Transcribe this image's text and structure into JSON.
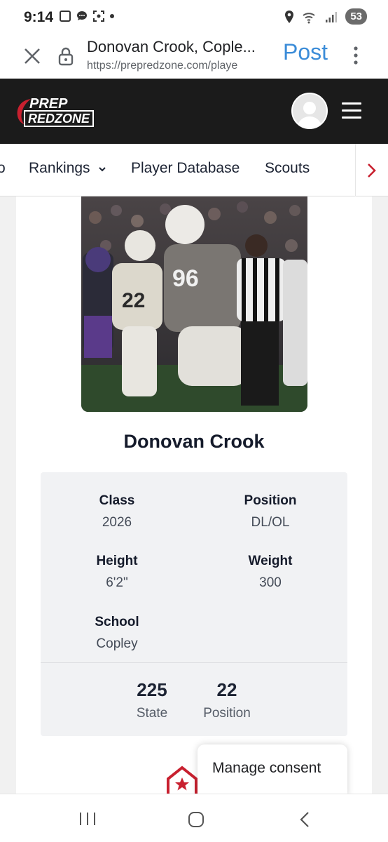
{
  "status_bar": {
    "time": "9:14",
    "battery": "53",
    "icons": [
      "notification-square-icon",
      "chat-bubble-icon",
      "screenshot-icon",
      "dot-icon",
      "location-icon",
      "wifi-icon",
      "signal-icon"
    ]
  },
  "browser": {
    "page_title": "Donovan Crook, Cople...",
    "url": "https://prepredzone.com/playe",
    "action_label": "Post",
    "accent": "#3b8cd8"
  },
  "site": {
    "logo_top": "PREP",
    "logo_bottom": "REDZONE",
    "brand_red": "#c8202f",
    "header_bg": "#1b1b1b"
  },
  "nav": {
    "partial_item": "o",
    "items": [
      "Rankings",
      "Player Database",
      "Scouts"
    ]
  },
  "player": {
    "name": "Donovan Crook",
    "fields": [
      {
        "label": "Class",
        "value": "2026"
      },
      {
        "label": "Position",
        "value": "DL/OL"
      },
      {
        "label": "Height",
        "value": "6'2\""
      },
      {
        "label": "Weight",
        "value": "300"
      },
      {
        "label": "School",
        "value": "Copley"
      }
    ],
    "ranks": [
      {
        "number": "225",
        "label": "State"
      },
      {
        "number": "22",
        "label": "Position"
      }
    ]
  },
  "consent": {
    "label": "Manage consent"
  }
}
